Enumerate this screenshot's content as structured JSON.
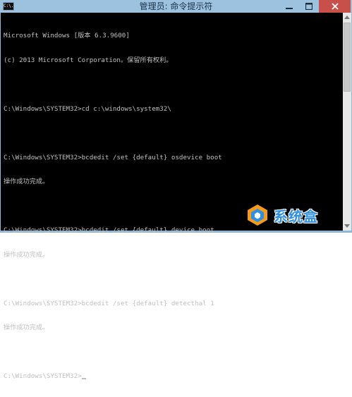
{
  "window": {
    "title": "管理员: 命令提示符",
    "app_icon_text": "C:\\."
  },
  "console": {
    "lines": [
      "Microsoft Windows [版本 6.3.9600]",
      "(c) 2013 Microsoft Corporation。保留所有权利。",
      "",
      "C:\\Windows\\SYSTEM32>cd c:\\windows\\system32\\",
      "",
      "C:\\Windows\\SYSTEM32>bcdedit /set {default} osdevice boot",
      "操作成功完成。",
      "",
      "C:\\Windows\\SYSTEM32>bcdedit /set {default} device boot",
      "操作成功完成。",
      "",
      "C:\\Windows\\SYSTEM32>bcdedit /set {default} detecthal 1",
      "操作成功完成。",
      "",
      "C:\\Windows\\SYSTEM32>"
    ]
  },
  "watermark": {
    "text": "系统盒"
  },
  "colors": {
    "titlebar": "#9cc2df",
    "console_bg": "#000000",
    "console_fg": "#c0c0c0",
    "close_button": "#c7504a",
    "watermark": "#2f8fe0"
  }
}
